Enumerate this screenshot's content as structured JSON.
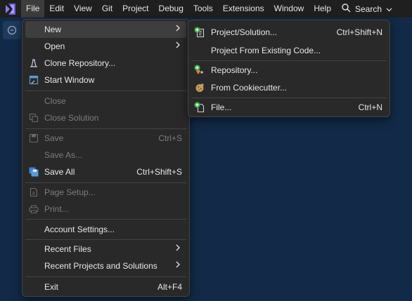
{
  "menubar": {
    "items": [
      "File",
      "Edit",
      "View",
      "Git",
      "Project",
      "Debug",
      "Tools",
      "Extensions",
      "Window",
      "Help"
    ],
    "search_label": "Search"
  },
  "file_menu": {
    "new": "New",
    "open": "Open",
    "clone_repository": "Clone Repository...",
    "start_window": "Start Window",
    "close": "Close",
    "close_solution": "Close Solution",
    "save": "Save",
    "save_shortcut": "Ctrl+S",
    "save_as": "Save As...",
    "save_all": "Save All",
    "save_all_shortcut": "Ctrl+Shift+S",
    "page_setup": "Page Setup...",
    "print": "Print...",
    "account_settings": "Account Settings...",
    "recent_files": "Recent Files",
    "recent_projects": "Recent Projects and Solutions",
    "exit": "Exit",
    "exit_shortcut": "Alt+F4"
  },
  "new_menu": {
    "project_solution": "Project/Solution...",
    "project_solution_shortcut": "Ctrl+Shift+N",
    "project_from_existing": "Project From Existing Code...",
    "repository": "Repository...",
    "from_cookiecutter": "From Cookiecutter...",
    "file": "File...",
    "file_shortcut": "Ctrl+N"
  },
  "colors": {
    "background": "#122a47",
    "menubar": "#1f1f1f",
    "menu": "#292929",
    "highlight": "#3e3e3e",
    "disabled_text": "#7c7c7c",
    "logo": "#8a7cf0",
    "add_icon": "#3fae49"
  }
}
